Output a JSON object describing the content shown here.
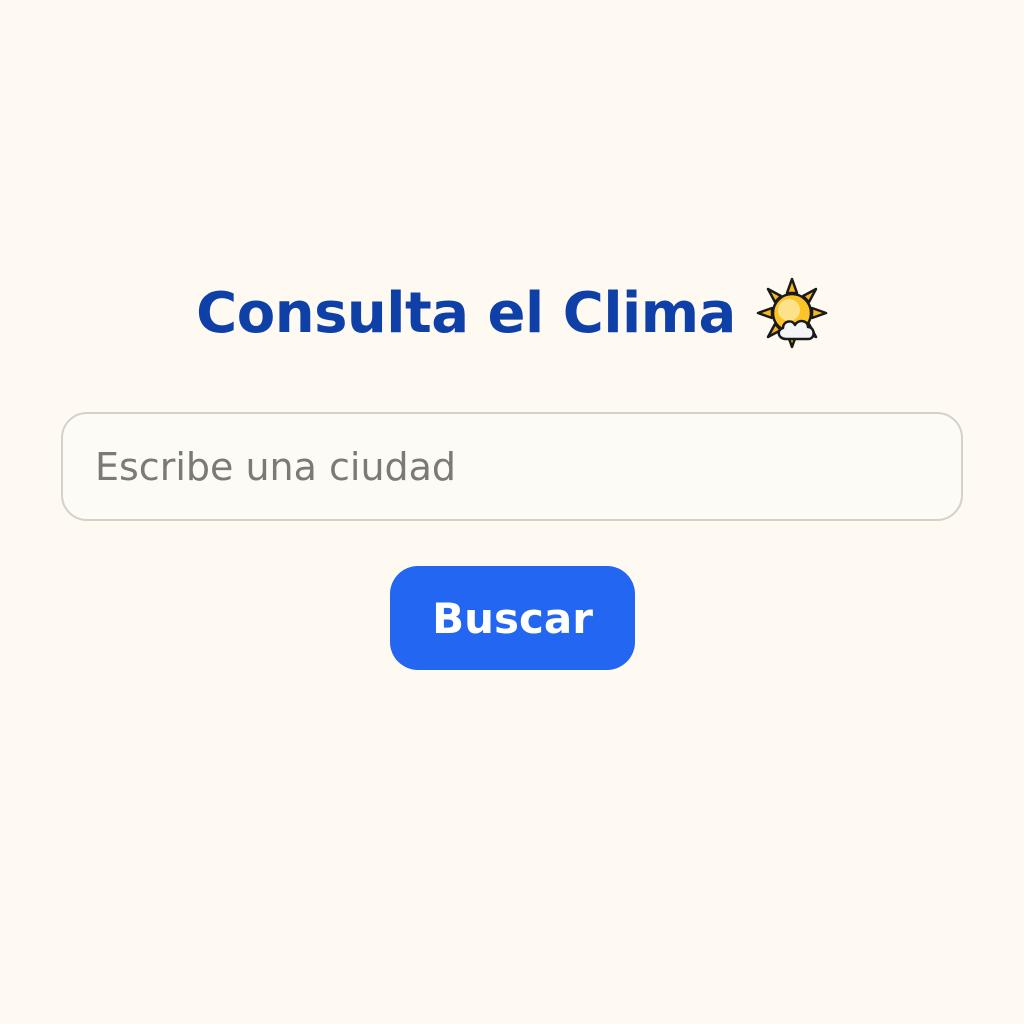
{
  "header": {
    "title": "Consulta el Clima",
    "icon": "sun-behind-cloud-icon"
  },
  "search": {
    "placeholder": "Escribe una ciudad",
    "value": ""
  },
  "actions": {
    "search_label": "Buscar"
  },
  "colors": {
    "background": "#fefaf2",
    "title": "#0f40a8",
    "button": "#2266f2",
    "input_border": "#d4d0ca",
    "sun": "#f6b81c",
    "sun_outline": "#1a1a1a"
  }
}
